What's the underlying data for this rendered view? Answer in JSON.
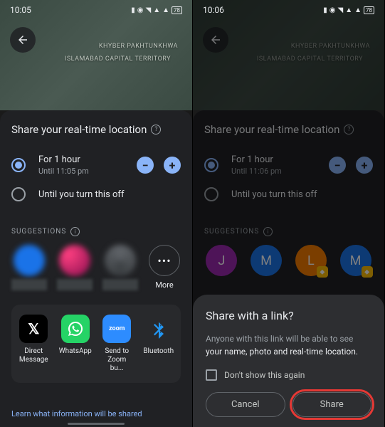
{
  "left": {
    "time": "10:05",
    "map_labels": [
      "KHYBER PAKHTUNKHWA",
      "ISLAMABAD CAPITAL TERRITORY"
    ],
    "title": "Share your real-time location",
    "options": [
      {
        "main": "For 1 hour",
        "sub": "Until 11:05 pm",
        "selected": true
      },
      {
        "main": "Until you turn this off",
        "selected": false
      }
    ],
    "suggestions_label": "SUGGESTIONS",
    "more_label": "More",
    "apps": [
      {
        "label": "Direct Message"
      },
      {
        "label": "WhatsApp"
      },
      {
        "label": "Send to Zoom bu..."
      },
      {
        "label": "Bluetooth"
      }
    ],
    "footer_link": "Learn what information will be shared"
  },
  "right": {
    "time": "10:06",
    "map_labels": [
      "KHYBER PAKHTUNKHWA",
      "ISLAMABAD CAPITAL TERRITORY"
    ],
    "title": "Share your real-time location",
    "options": [
      {
        "main": "For 1 hour",
        "sub": "Until 11:06 pm",
        "selected": true
      },
      {
        "main": "Until you turn this off",
        "selected": false
      }
    ],
    "suggestions_label": "SUGGESTIONS",
    "contacts": [
      {
        "initial": "J",
        "color": "#9c27b0"
      },
      {
        "initial": "M",
        "color": "#1a73e8"
      },
      {
        "initial": "L",
        "color": "#f57c00",
        "badge": true
      },
      {
        "initial": "M",
        "color": "#1a73e8",
        "badge": true
      }
    ],
    "dialog": {
      "title": "Share with a link?",
      "body_pre": "Anyone with this link will be able to see ",
      "body_em": "your name, photo and real-time location.",
      "checkbox": "Don't show this again",
      "cancel": "Cancel",
      "share": "Share"
    }
  }
}
